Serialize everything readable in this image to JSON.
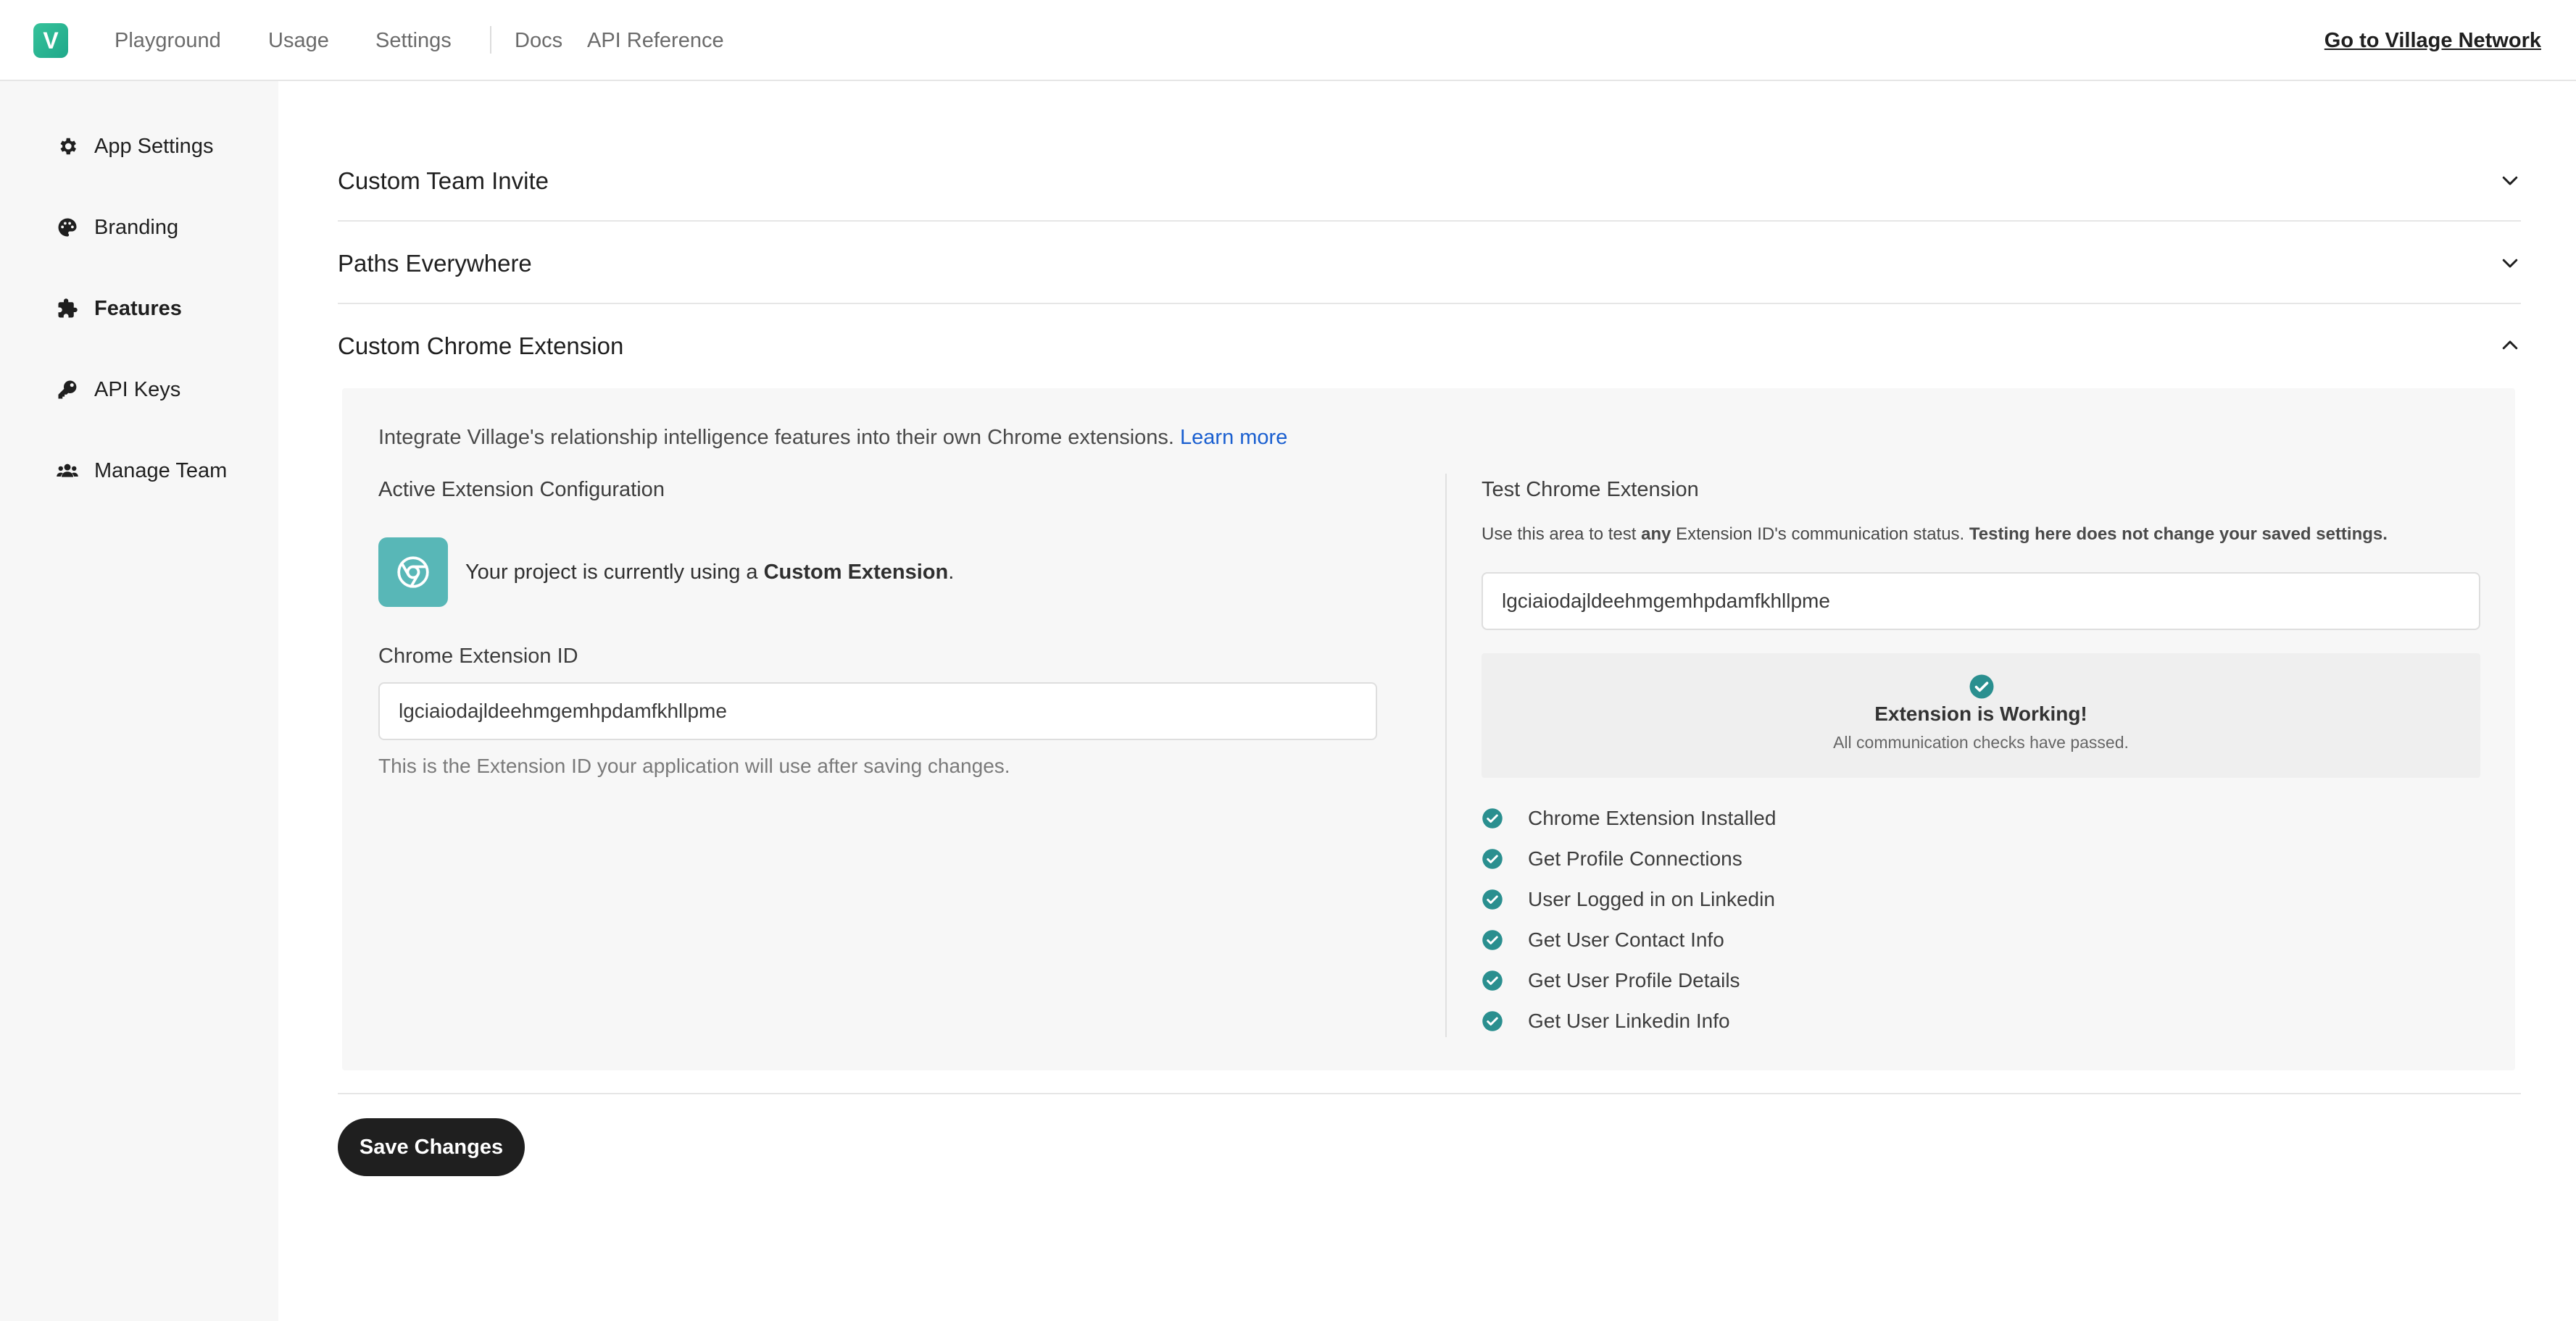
{
  "topnav": {
    "logo_letter": "V",
    "links": [
      "Playground",
      "Usage",
      "Settings",
      "Docs",
      "API Reference"
    ],
    "village_link": "Go to Village Network"
  },
  "sidebar": {
    "items": [
      {
        "label": "App Settings",
        "icon": "gear-icon"
      },
      {
        "label": "Branding",
        "icon": "palette-icon"
      },
      {
        "label": "Features",
        "icon": "puzzle-icon",
        "active": true
      },
      {
        "label": "API Keys",
        "icon": "key-icon"
      },
      {
        "label": "Manage Team",
        "icon": "users-icon"
      }
    ]
  },
  "accordion": {
    "sections": [
      {
        "title": "Custom Team Invite",
        "expanded": false
      },
      {
        "title": "Paths Everywhere",
        "expanded": false
      },
      {
        "title": "Custom Chrome Extension",
        "expanded": true
      }
    ]
  },
  "chrome_extension": {
    "intro": "Integrate Village's relationship intelligence features into their own Chrome extensions.",
    "learn_more": "Learn more",
    "active_config_title": "Active Extension Configuration",
    "using_prefix": "Your project is currently using a",
    "using_bold": "Custom Extension",
    "using_suffix": ".",
    "id_label": "Chrome Extension ID",
    "id_value": "lgciaiodajldeehmgemhpdamfkhllpme",
    "id_helper": "This is the Extension ID your application will use after saving changes.",
    "test_title": "Test Chrome Extension",
    "test_desc_1": "Use this area to test",
    "test_desc_bold1": "any",
    "test_desc_2": "Extension ID's communication status.",
    "test_desc_bold2": "Testing here does not change your saved settings.",
    "test_input_value": "lgciaiodajldeehmgemhpdamfkhllpme",
    "status_title": "Extension is Working!",
    "status_sub": "All communication checks have passed.",
    "checks": [
      "Chrome Extension Installed",
      "Get Profile Connections",
      "User Logged in on Linkedin",
      "Get User Contact Info",
      "Get User Profile Details",
      "Get User Linkedin Info"
    ]
  },
  "save_label": "Save Changes",
  "colors": {
    "brand": "#1fa88a",
    "check": "#2a8f8f",
    "extension_tile": "#58b7b7",
    "link": "#1a5fd0",
    "save_button": "#1f1f1f"
  }
}
